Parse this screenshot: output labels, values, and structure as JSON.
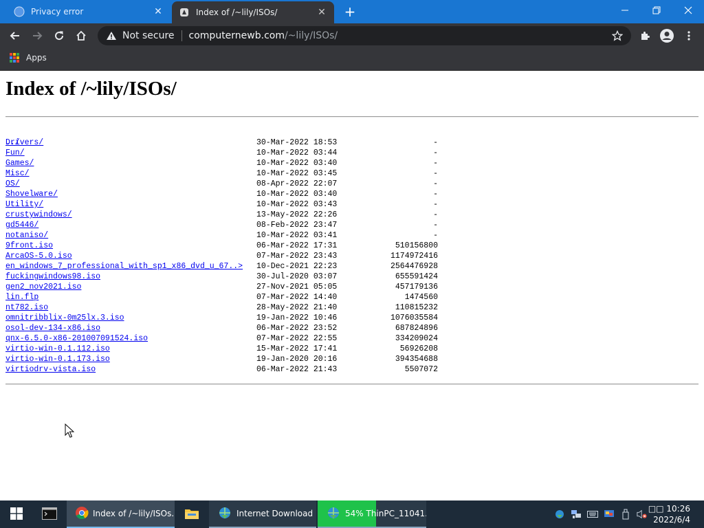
{
  "browser": {
    "tabs": [
      {
        "title": "Privacy error",
        "active": false
      },
      {
        "title": "Index of /~lily/ISOs/",
        "active": true
      }
    ],
    "new_tab_label": "+",
    "omnibox": {
      "security_label": "Not secure",
      "host": "computernewb.com",
      "path": "/~lily/ISOs/"
    },
    "bookmarks": {
      "apps_label": "Apps"
    }
  },
  "page": {
    "heading": "Index of /~lily/ISOs/",
    "parent_link": "../",
    "entries": [
      {
        "name": "Drivers/",
        "date": "30-Mar-2022 18:53",
        "size": "-"
      },
      {
        "name": "Fun/",
        "date": "10-Mar-2022 03:44",
        "size": "-"
      },
      {
        "name": "Games/",
        "date": "10-Mar-2022 03:40",
        "size": "-"
      },
      {
        "name": "Misc/",
        "date": "10-Mar-2022 03:45",
        "size": "-"
      },
      {
        "name": "OS/",
        "date": "08-Apr-2022 22:07",
        "size": "-"
      },
      {
        "name": "Shovelware/",
        "date": "10-Mar-2022 03:40",
        "size": "-"
      },
      {
        "name": "Utility/",
        "date": "10-Mar-2022 03:43",
        "size": "-"
      },
      {
        "name": "crustywindows/",
        "date": "13-May-2022 22:26",
        "size": "-"
      },
      {
        "name": "gd5446/",
        "date": "08-Feb-2022 23:47",
        "size": "-"
      },
      {
        "name": "notaniso/",
        "date": "10-Mar-2022 03:41",
        "size": "-"
      },
      {
        "name": "9front.iso",
        "date": "06-Mar-2022 17:31",
        "size": "510156800"
      },
      {
        "name": "ArcaOS-5.0.iso",
        "date": "07-Mar-2022 23:43",
        "size": "1174972416"
      },
      {
        "name": "en_windows_7_professional_with_sp1_x86_dvd_u_67..>",
        "date": "10-Dec-2021 22:23",
        "size": "2564476928"
      },
      {
        "name": "fuckingwindows98.iso",
        "date": "30-Jul-2020 03:07",
        "size": "655591424"
      },
      {
        "name": "gen2_nov2021.iso",
        "date": "27-Nov-2021 05:05",
        "size": "457179136"
      },
      {
        "name": "lin.flp",
        "date": "07-Mar-2022 14:40",
        "size": "1474560"
      },
      {
        "name": "nt782.iso",
        "date": "28-May-2022 21:40",
        "size": "110815232"
      },
      {
        "name": "omnitribblix-0m25lx.3.iso",
        "date": "19-Jan-2022 10:46",
        "size": "1076035584"
      },
      {
        "name": "osol-dev-134-x86.iso",
        "date": "06-Mar-2022 23:52",
        "size": "687824896"
      },
      {
        "name": "qnx-6.5.0-x86-201007091524.iso",
        "date": "07-Mar-2022 22:55",
        "size": "334209024"
      },
      {
        "name": "virtio-win-0.1.112.iso",
        "date": "15-Mar-2022 17:41",
        "size": "56926208"
      },
      {
        "name": "virtio-win-0.1.173.iso",
        "date": "19-Jan-2020 20:16",
        "size": "394354688"
      },
      {
        "name": "virtiodrv-vista.iso",
        "date": "06-Mar-2022 21:43",
        "size": "5507072"
      }
    ]
  },
  "taskbar": {
    "items": [
      {
        "label": "Index of /~lily/ISOs..."
      },
      {
        "label": "Internet Download ..."
      },
      {
        "label": "54% ThinPC_11041...",
        "progress": 0.54
      }
    ],
    "clock": {
      "time": "□□ 10:26",
      "date": "2022/6/4"
    }
  },
  "colors": {
    "tabbar": "#1976d2",
    "chrome_dark": "#35363a",
    "link": "#0000ee",
    "taskbar": "#1d2b39",
    "progress": "#1fc24a"
  },
  "icons": {
    "tab_inactive": "globe-icon",
    "tab_active": "site-favicon-icon",
    "security": "warning-triangle-icon",
    "bookmark": "star-icon",
    "extensions": "puzzle-icon",
    "profile": "account-icon"
  }
}
